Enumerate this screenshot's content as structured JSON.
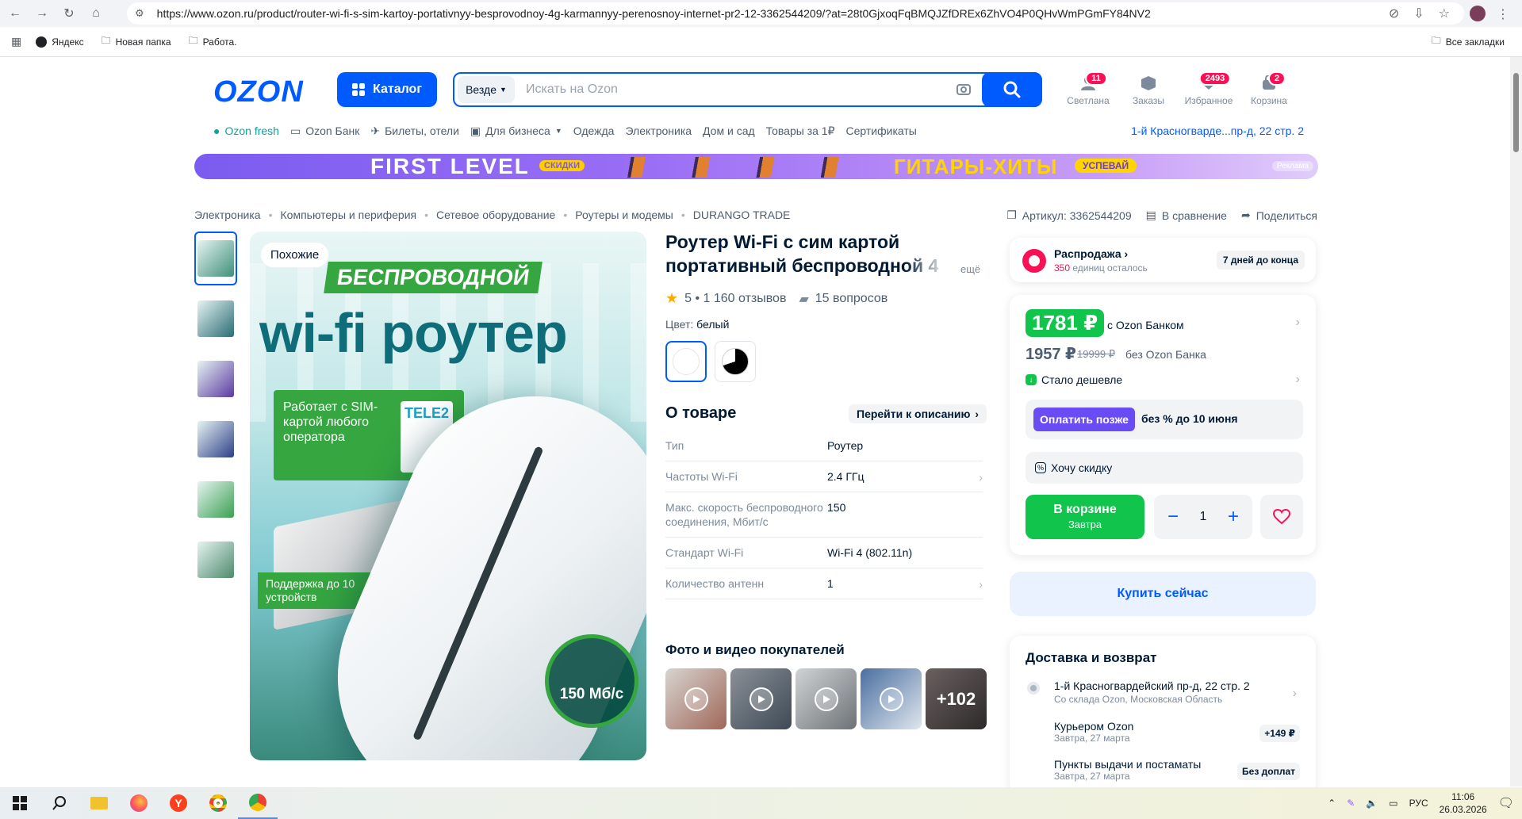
{
  "browser": {
    "url": "https://www.ozon.ru/product/router-wi-fi-s-sim-kartoy-portativnyy-besprovodnoy-4g-karmannyy-perenosnoy-internet-pr2-12-3362544209/?at=28t0GjxoqFqBMQJZfDREx6ZhVO4P0QHvWmPGmFY84NV2",
    "bookmarks": [
      "Яндекс",
      "Новая папка",
      "Работа."
    ],
    "all_bookmarks": "Все закладки"
  },
  "header": {
    "logo": "OZON",
    "catalog_label": "Каталог",
    "search_scope": "Везде",
    "search_placeholder": "Искать на Ozon",
    "icons": [
      {
        "label": "Светлана",
        "badge": "11",
        "icon": "profile-icon"
      },
      {
        "label": "Заказы",
        "badge": "",
        "icon": "orders-icon"
      },
      {
        "label": "Избранное",
        "badge": "2493",
        "icon": "heart-icon"
      },
      {
        "label": "Корзина",
        "badge": "2",
        "icon": "cart-icon"
      }
    ]
  },
  "topnav": {
    "items": [
      "Ozon fresh",
      "Ozon Банк",
      "Билеты, отели",
      "Для бизнеса",
      "Одежда",
      "Электроника",
      "Дом и сад",
      "Товары за 1₽",
      "Сертификаты"
    ],
    "location": "1-й Красногварде...пр-д, 22 стр. 2"
  },
  "banner": {
    "left_text": "FIRST LEVEL",
    "tag": "СКИДКИ",
    "right_text": "ГИТАРЫ-ХИТЫ",
    "button": "УСПЕВАЙ",
    "ad": "Реклама"
  },
  "breadcrumbs": [
    "Электроника",
    "Компьютеры и периферия",
    "Сетевое оборудование",
    "Роутеры и модемы",
    "DURANGO TRADE"
  ],
  "meta": {
    "article": "Артикул: 3362544209",
    "compare": "В сравнение",
    "share": "Поделиться"
  },
  "gallery": {
    "similar": "Похожие",
    "banner": "БЕСПРОВОДНОЙ",
    "title": "wi-fi роутер",
    "card1": "Работает с SIM-картой любого оператора",
    "operator": "TELE2",
    "card2": "Поддержка до 10 устройств",
    "speed": "150 Мб/с",
    "thumb_colors": [
      "#3f8f7a",
      "#2a6c75",
      "#5a3aa0",
      "#2d3f88",
      "#3aa050",
      "#4d8a6a"
    ]
  },
  "product": {
    "title_line1": "Роутер Wi-Fi с сим картой",
    "title_line2": "портативный беспроводной 4",
    "more": "ещё",
    "rating": "5 • 1 160 отзывов",
    "questions": "15 вопросов",
    "color_label": "Цвет:",
    "color_value": "белый",
    "about": "О товаре",
    "go_desc": "Перейти к описанию",
    "specs": [
      {
        "k": "Тип",
        "v": "Роутер",
        "chev": false
      },
      {
        "k": "Частоты Wi-Fi",
        "v": "2.4 ГГц",
        "chev": true
      },
      {
        "k": "Макс. скорость беспроводного соединения, Мбит/с",
        "v": "150",
        "chev": false
      },
      {
        "k": "Стандарт Wi-Fi",
        "v": "Wi-Fi 4 (802.11n)",
        "chev": false
      },
      {
        "k": "Количество антенн",
        "v": "1",
        "chev": true
      }
    ],
    "photos_title": "Фото и видео покупателей",
    "photos_more": "+102"
  },
  "buybox": {
    "sale_title": "Распродажа",
    "sale_count": "350",
    "sale_units": "единиц осталось",
    "sale_days": "7 дней до конца",
    "price_bank": "1781 ₽",
    "price_bank_label": "с Ozon Банком",
    "price": "1957 ₽",
    "price_old": "19999 ₽",
    "price_label": "без Ozon Банка",
    "cheaper": "Стало дешевле",
    "pay_later": "Оплатить позже",
    "pay_later_text": "без % до 10 июня",
    "discount": "Хочу скидку",
    "cart_label": "В корзине",
    "cart_sub": "Завтра",
    "qty": "1",
    "buy_now": "Купить сейчас"
  },
  "delivery": {
    "title": "Доставка и возврат",
    "address": "1-й Красногвардейский пр-д, 22 стр. 2",
    "address_sub": "Со склада Ozon, Московская Область",
    "rows": [
      {
        "t": "Курьером Ozon",
        "s": "Завтра, 27 марта",
        "p": "+149 ₽"
      },
      {
        "t": "Пункты выдачи и постаматы",
        "s": "Завтра, 27 марта",
        "p": "Без доплат"
      }
    ]
  },
  "taskbar": {
    "lang": "РУС",
    "time": "11:06",
    "date": "26.03.2026"
  },
  "colors": {
    "brand": "#005bff",
    "green": "#10c44c",
    "pink": "#f91155"
  }
}
